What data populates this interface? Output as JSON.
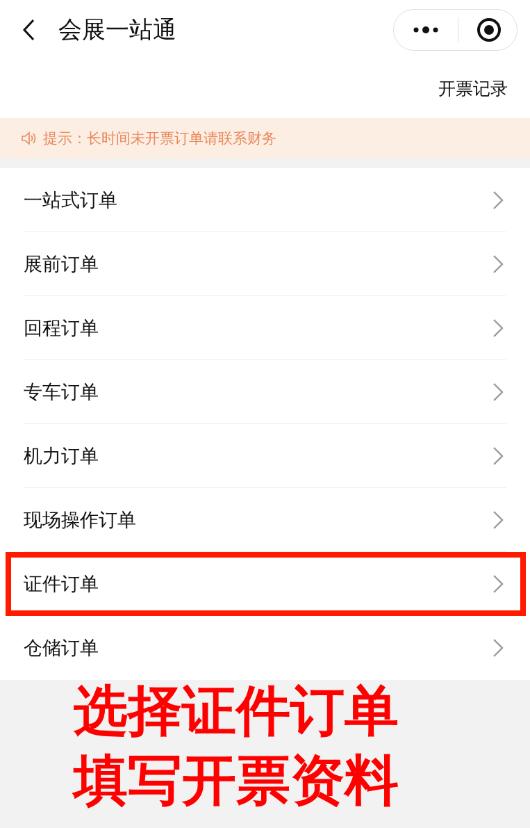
{
  "nav_bar": {
    "title": "会展一站通"
  },
  "records_link": "开票记录",
  "notice": "提示：长时间未开票订单请联系财务",
  "items": [
    {
      "label": "一站式订单",
      "highlighted": false
    },
    {
      "label": "展前订单",
      "highlighted": false
    },
    {
      "label": "回程订单",
      "highlighted": false
    },
    {
      "label": "专车订单",
      "highlighted": false
    },
    {
      "label": "机力订单",
      "highlighted": false
    },
    {
      "label": "现场操作订单",
      "highlighted": false
    },
    {
      "label": "证件订单",
      "highlighted": true
    },
    {
      "label": "仓储订单",
      "highlighted": false
    }
  ],
  "caption": [
    "选择证件订单",
    "填写开票资料"
  ]
}
